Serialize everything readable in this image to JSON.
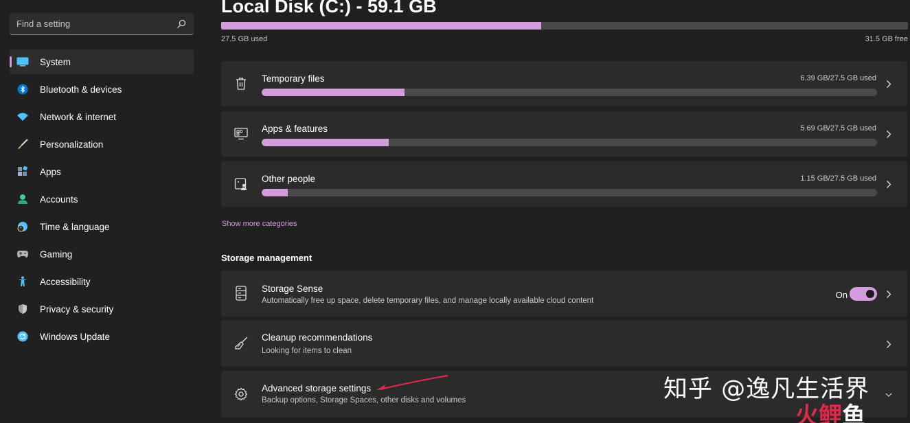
{
  "search": {
    "placeholder": "Find a setting"
  },
  "sidebar": {
    "items": [
      {
        "label": "System",
        "icon": "system-icon",
        "color": "#4cc2ff"
      },
      {
        "label": "Bluetooth & devices",
        "icon": "bluetooth-icon",
        "color": "#0078d4"
      },
      {
        "label": "Network & internet",
        "icon": "wifi-icon",
        "color": "#4cc2ff"
      },
      {
        "label": "Personalization",
        "icon": "brush-icon",
        "color": "#e8a86a"
      },
      {
        "label": "Apps",
        "icon": "apps-icon",
        "color": "#9fb4cc"
      },
      {
        "label": "Accounts",
        "icon": "accounts-icon",
        "color": "#3ecf8e"
      },
      {
        "label": "Time & language",
        "icon": "globe-clock-icon",
        "color": "#4cc2ff"
      },
      {
        "label": "Gaming",
        "icon": "gamepad-icon",
        "color": "#b0b0b0"
      },
      {
        "label": "Accessibility",
        "icon": "accessibility-icon",
        "color": "#4cc2ff"
      },
      {
        "label": "Privacy & security",
        "icon": "shield-icon",
        "color": "#9a9a9a"
      },
      {
        "label": "Windows Update",
        "icon": "update-icon",
        "color": "#4cc2ff"
      }
    ]
  },
  "disk": {
    "title": "Local Disk (C:) - 59.1 GB",
    "used_label": "27.5 GB used",
    "free_label": "31.5 GB free",
    "used_fraction": 0.466
  },
  "categories": [
    {
      "title": "Temporary files",
      "value": "6.39 GB/27.5 GB used",
      "fraction": 0.232,
      "icon": "trash-icon"
    },
    {
      "title": "Apps & features",
      "value": "5.69 GB/27.5 GB used",
      "fraction": 0.207,
      "icon": "apps-features-icon"
    },
    {
      "title": "Other people",
      "value": "1.15 GB/27.5 GB used",
      "fraction": 0.042,
      "icon": "other-people-icon"
    }
  ],
  "show_more": "Show more categories",
  "storage_management": {
    "heading": "Storage management",
    "storage_sense": {
      "title": "Storage Sense",
      "subtitle": "Automatically free up space, delete temporary files, and manage locally available cloud content",
      "toggle_label": "On",
      "toggle_on": true
    },
    "cleanup": {
      "title": "Cleanup recommendations",
      "subtitle": "Looking for items to clean"
    },
    "advanced": {
      "title": "Advanced storage settings",
      "subtitle": "Backup options, Storage Spaces, other disks and volumes"
    }
  },
  "watermark": {
    "text": "知乎 @逸凡生活界",
    "brand_parts": [
      "火",
      "鲤",
      "鱼"
    ]
  },
  "colors": {
    "accent": "#d39ddd",
    "background": "#202020",
    "card": "#2b2b2b",
    "annotation_arrow": "#e0294a"
  }
}
